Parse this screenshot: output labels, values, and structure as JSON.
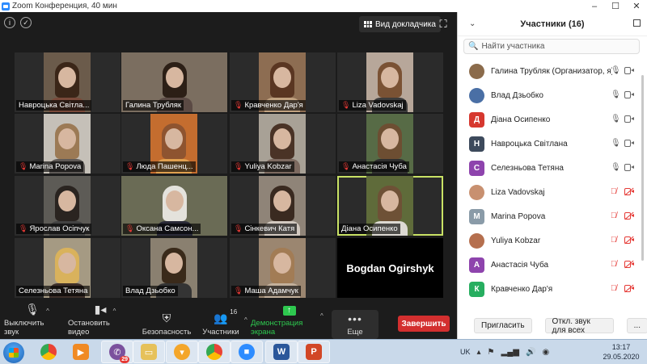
{
  "window": {
    "title": "Zoom Конференция, 40 мин",
    "minimize": "–",
    "maximize": "☐",
    "close": "✕"
  },
  "meeting": {
    "speaker_view_label": "Вид докладчика",
    "tiles": [
      {
        "name": "Навроцька Світла...",
        "muted": false,
        "bg": "#6b5b4b",
        "hair": "#3b2618",
        "body": "#7a4a3a"
      },
      {
        "name": "Галина Трубляк",
        "muted": false,
        "bg": "#7b6e60",
        "hair": "#2c1f16",
        "body": "#5b4a44"
      },
      {
        "name": "Кравченко Дар'я",
        "muted": true,
        "bg": "#8d6d52",
        "hair": "#5a3622",
        "body": "#c1a280"
      },
      {
        "name": "Liza Vadovskaj",
        "muted": true,
        "bg": "#b7a79a",
        "hair": "#7a5234",
        "body": "#3c3c3c"
      },
      {
        "name": "Marina Popova",
        "muted": true,
        "bg": "#c5c0b8",
        "hair": "#9c7a55",
        "body": "#5f5a57"
      },
      {
        "name": "Люда Пашенц...",
        "muted": true,
        "bg": "#c46d2f",
        "hair": "#8e5430",
        "body": "#e1a150"
      },
      {
        "name": "Yuliya Kobzar",
        "muted": true,
        "bg": "#a8a196",
        "hair": "#4a3326",
        "body": "#7d6a60"
      },
      {
        "name": "Анастасія Чуба",
        "muted": true,
        "bg": "#576b46",
        "hair": "#6d4e32",
        "body": "#2f2f2f"
      },
      {
        "name": "Ярослав Осіпчук",
        "muted": true,
        "bg": "#5d5b56",
        "hair": "#2a2420",
        "body": "#424242"
      },
      {
        "name": "Оксана Самсон...",
        "muted": true,
        "bg": "#6a6b55",
        "hair": "#e4e2dc",
        "body": "#2a2a38"
      },
      {
        "name": "Сінкевич Катя",
        "muted": true,
        "bg": "#8f8478",
        "hair": "#3a2a20",
        "body": "#d2c9c0"
      },
      {
        "name": "Діана Осипенко",
        "muted": false,
        "bg": "#5f6b3a",
        "hair": "#6e5136",
        "body": "#dcd9d2"
      },
      {
        "name": "Селезньова Тетяна",
        "muted": false,
        "bg": "#a59a83",
        "hair": "#d9b25c",
        "body": "#3e2f2a"
      },
      {
        "name": "Влад Дзьобко",
        "muted": false,
        "bg": "#8a8070",
        "hair": "#3a2a1a",
        "body": "#343434"
      },
      {
        "name": "Маша Адамчук",
        "muted": true,
        "bg": "#9b8670",
        "hair": "#a27c55",
        "body": "#c3b09b"
      },
      {
        "name": "Bogdan Ogirshyk",
        "muted": false,
        "bg": "#000000"
      }
    ]
  },
  "toolbar": {
    "mute_label": "Выключить звук",
    "video_label": "Остановить видео",
    "security_label": "Безопасность",
    "participants_label": "Участники",
    "participants_count": "16",
    "share_label": "Демонстрация экрана",
    "more_label": "Еще",
    "end_label": "Завершить"
  },
  "panel": {
    "title": "Участники (16)",
    "search_placeholder": "Найти участника",
    "participants": [
      {
        "name": "Галина Трубляк (Организатор, я)",
        "initial": "",
        "color": "#8b6b4b",
        "mic_on": true,
        "cam_on": true
      },
      {
        "name": "Влад Дзьобко",
        "initial": "",
        "color": "#4a6fa5",
        "mic_on": true,
        "cam_on": true
      },
      {
        "name": "Діана Осипенко",
        "initial": "Д",
        "color": "#d6382f",
        "mic_on": true,
        "cam_on": true
      },
      {
        "name": "Навроцька Світлана",
        "initial": "Н",
        "color": "#3d4a5c",
        "mic_on": true,
        "cam_on": true
      },
      {
        "name": "Селезньова Тетяна",
        "initial": "С",
        "color": "#8e44ad",
        "mic_on": true,
        "cam_on": true
      },
      {
        "name": "Liza Vadovskaj",
        "initial": "",
        "color": "#c89070",
        "mic_on": false,
        "cam_on": false
      },
      {
        "name": "Marina Popova",
        "initial": "M",
        "color": "#8a9ba8",
        "mic_on": false,
        "cam_on": false
      },
      {
        "name": "Yuliya Kobzar",
        "initial": "",
        "color": "#b56f4e",
        "mic_on": false,
        "cam_on": false
      },
      {
        "name": "Анастасія Чуба",
        "initial": "A",
        "color": "#8e44ad",
        "mic_on": false,
        "cam_on": false
      },
      {
        "name": "Кравченко Дар'я",
        "initial": "К",
        "color": "#27ae60",
        "mic_on": false,
        "cam_on": false
      }
    ],
    "invite_label": "Пригласить",
    "mute_all_label": "Откл. звук для всех",
    "more_label": "..."
  },
  "taskbar": {
    "viber_badge": "29",
    "lang": "UK",
    "time": "13:17",
    "date": "29.05.2020"
  }
}
